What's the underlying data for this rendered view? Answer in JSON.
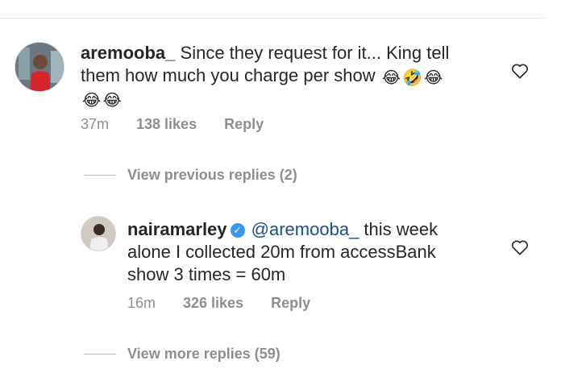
{
  "comment": {
    "username": "aremooba_",
    "text_line1": "Since they request for it... King tell",
    "text_line2": "them how much you charge per show",
    "emojis_line1": [
      "😂",
      "🤣",
      "😂"
    ],
    "emojis_line2": [
      "😂",
      "😂"
    ],
    "time": "37m",
    "likes": "138 likes",
    "reply_label": "Reply",
    "like_icon": "heart-outline-icon"
  },
  "view_previous_replies": "View previous replies (2)",
  "reply": {
    "username": "nairamarley",
    "verified_icon": "verified-badge-icon",
    "mention": "@aremooba_",
    "text_line1": "this week",
    "text_line2": "alone I collected 20m from accessBank",
    "text_line3": "show 3 times = 60m",
    "time": "16m",
    "likes": "326 likes",
    "reply_label": "Reply",
    "like_icon": "heart-outline-icon"
  },
  "view_more_replies": "View more replies (59)",
  "colors": {
    "text": "#262626",
    "secondary": "#8e8e8e",
    "verified": "#3897f0",
    "mention": "#1a4d8f"
  }
}
